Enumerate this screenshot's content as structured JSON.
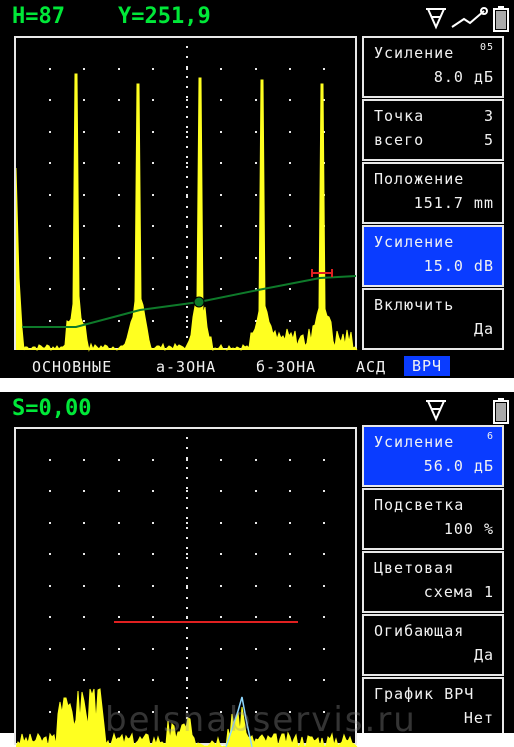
{
  "screen1": {
    "header": {
      "h": "H=87",
      "y": "Y=251,9"
    },
    "icons": [
      "probe-icon",
      "signal-icon",
      "battery-icon"
    ],
    "panels": [
      {
        "label": "Усиление",
        "sup": "05",
        "value": "8.0 дБ",
        "active": false
      },
      {
        "label": "Точка",
        "label_right": "3",
        "label2": "всего",
        "value": "5",
        "active": false
      },
      {
        "label": "Положение",
        "value": "151.7 mm",
        "active": false
      },
      {
        "label": "Усиление",
        "value": "15.0 dB",
        "active": true
      },
      {
        "label": "Включить",
        "value": "Да",
        "active": false
      }
    ],
    "menu": [
      {
        "label": "ОСНОВНЫЕ",
        "active": false
      },
      {
        "label": "а-ЗОНА",
        "active": false
      },
      {
        "label": "б-ЗОНА",
        "active": false
      },
      {
        "label": "АСД",
        "active": false
      },
      {
        "label": "ВРЧ",
        "active": true
      }
    ],
    "colors": {
      "signal": "#ffff20",
      "tvg_curve": "#0e7a2a",
      "gate": "#e02020",
      "active": "#0a3cff",
      "header": "#00e838"
    }
  },
  "screen2": {
    "header": {
      "s": "S=0,00"
    },
    "icons": [
      "probe-icon",
      "battery-icon"
    ],
    "panels": [
      {
        "label": "Усиление",
        "sup": "6",
        "value": "56.0 дБ",
        "active": true
      },
      {
        "label": "Подсветка",
        "value": "100 %",
        "active": false
      },
      {
        "label": "Цветовая",
        "value": "схема 1",
        "active": false
      },
      {
        "label": "Огибающая",
        "value": "Да",
        "active": false
      },
      {
        "label": "График ВРЧ",
        "value": "Нет",
        "active": false
      }
    ]
  },
  "watermark": "belsnabservis.ru"
}
